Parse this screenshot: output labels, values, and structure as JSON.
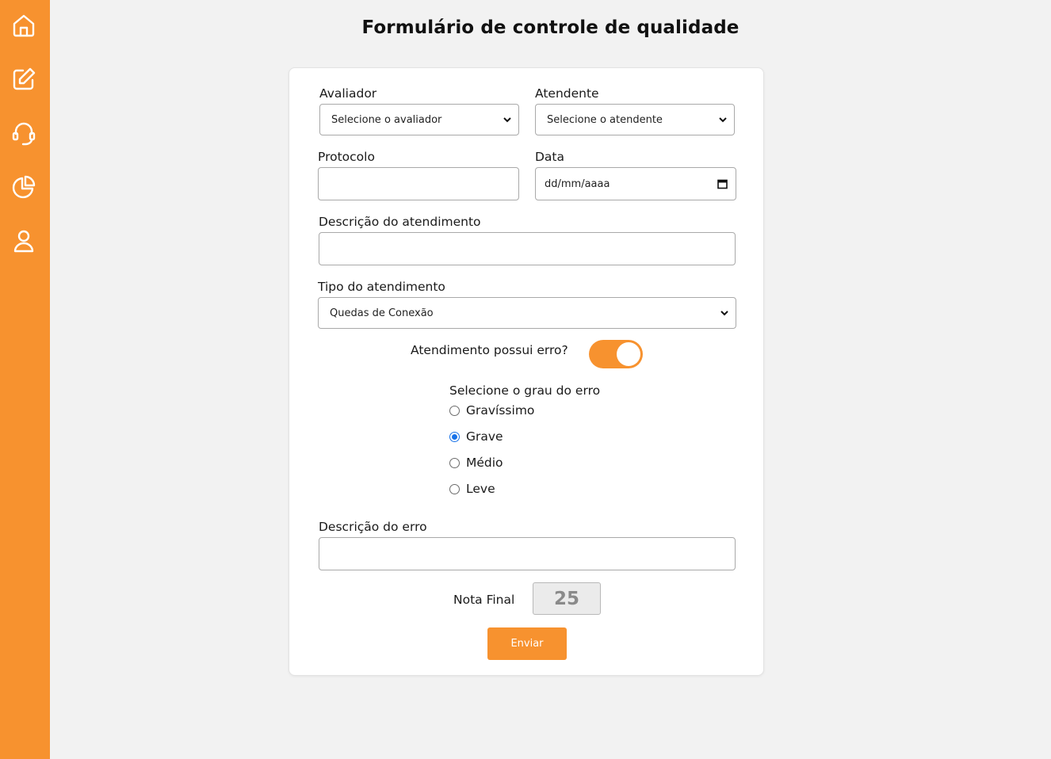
{
  "sidebar": {
    "items": [
      {
        "icon": "home-icon"
      },
      {
        "icon": "edit-icon"
      },
      {
        "icon": "headset-icon"
      },
      {
        "icon": "pie-chart-icon"
      },
      {
        "icon": "user-icon"
      }
    ]
  },
  "page": {
    "title": "Formulário de controle de qualidade"
  },
  "form": {
    "avaliador": {
      "label": "Avaliador",
      "value": "Selecione o avaliador"
    },
    "atendente": {
      "label": "Atendente",
      "value": "Selecione o atendente"
    },
    "protocolo": {
      "label": "Protocolo",
      "value": ""
    },
    "data": {
      "label": "Data",
      "placeholder": "dd/mm/aaaa"
    },
    "descricao_atendimento": {
      "label": "Descrição do atendimento",
      "value": ""
    },
    "tipo_atendimento": {
      "label": "Tipo do atendimento",
      "value": "Quedas de Conexão"
    },
    "possui_erro": {
      "label": "Atendimento possui erro?",
      "checked": true
    },
    "grau_erro": {
      "label": "Selecione o grau do erro",
      "options": [
        {
          "label": "Gravíssimo",
          "checked": false
        },
        {
          "label": "Grave",
          "checked": true
        },
        {
          "label": "Médio",
          "checked": false
        },
        {
          "label": "Leve",
          "checked": false
        }
      ]
    },
    "descricao_erro": {
      "label": "Descrição do erro",
      "value": ""
    },
    "nota_final": {
      "label": "Nota Final",
      "value": "25"
    },
    "submit_label": "Enviar"
  },
  "colors": {
    "accent": "#f7922f",
    "background": "#f2f2f2",
    "radio_selected": "#1a73e8"
  }
}
